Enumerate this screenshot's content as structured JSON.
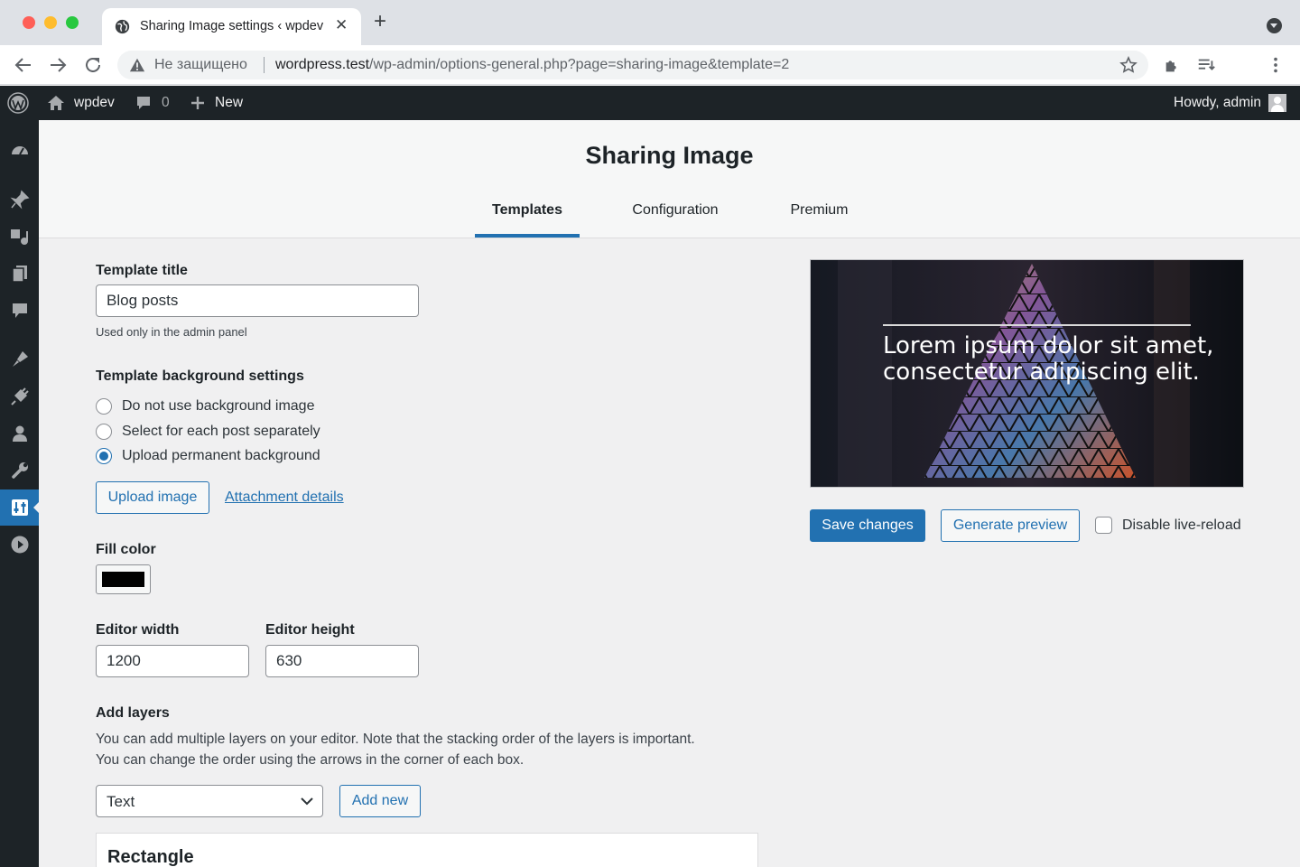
{
  "browser": {
    "tab_title": "Sharing Image settings ‹ wpdev",
    "security_label": "Не защищено",
    "url_host": "wordpress.test",
    "url_path": "/wp-admin/options-general.php?page=sharing-image&template=2"
  },
  "adminbar": {
    "site_name": "wpdev",
    "comments_count": "0",
    "new_label": "New",
    "greeting": "Howdy, admin"
  },
  "header": {
    "title": "Sharing Image",
    "tabs": [
      {
        "label": "Templates",
        "active": true
      },
      {
        "label": "Configuration",
        "active": false
      },
      {
        "label": "Premium",
        "active": false
      }
    ]
  },
  "form": {
    "template_title_label": "Template title",
    "template_title_value": "Blog posts",
    "template_title_desc": "Used only in the admin panel",
    "background_label": "Template background settings",
    "background_options": [
      {
        "label": "Do not use background image",
        "checked": false
      },
      {
        "label": "Select for each post separately",
        "checked": false
      },
      {
        "label": "Upload permanent background",
        "checked": true
      }
    ],
    "upload_image_label": "Upload image",
    "attachment_details_label": "Attachment details",
    "fill_color_label": "Fill color",
    "fill_color_value": "#000000",
    "editor_width_label": "Editor width",
    "editor_width_value": "1200",
    "editor_height_label": "Editor height",
    "editor_height_value": "630",
    "add_layers_label": "Add layers",
    "add_layers_desc_1": "You can add multiple layers on your editor. Note that the stacking order of the layers is important.",
    "add_layers_desc_2": "You can change the order using the arrows in the corner of each box.",
    "layer_type_value": "Text",
    "add_new_label": "Add new",
    "layer_card_title": "Rectangle"
  },
  "preview": {
    "text_line_1": "Lorem ipsum dolor sit amet,",
    "text_line_2": "consectetur adipiscing elit.",
    "save_label": "Save changes",
    "generate_label": "Generate preview",
    "live_reload_label": "Disable live-reload",
    "live_reload_checked": false
  },
  "colors": {
    "accent": "#2271b1",
    "admin_bar": "#1d2327",
    "background": "#f0f0f1"
  }
}
